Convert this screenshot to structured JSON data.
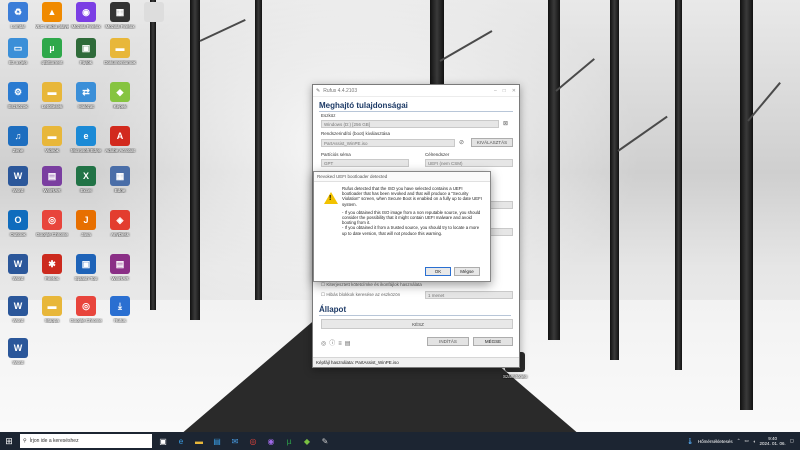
{
  "desktop": {
    "icons": [
      {
        "label": "Lomtár",
        "icon": "recycle-bin-icon",
        "color": "#3b7dd8",
        "glyph": "♻"
      },
      {
        "label": "VLC media player",
        "icon": "vlc-icon",
        "color": "#f08a00",
        "glyph": "▲"
      },
      {
        "label": "Mozilla Firefox",
        "icon": "firefox-icon",
        "color": "#7b3fe4",
        "glyph": "◉"
      },
      {
        "label": "Mozilla Firefox",
        "icon": "unknown-app-icon",
        "color": "#333333",
        "glyph": "▦"
      },
      {
        "label": "",
        "icon": "shortcut-icon",
        "color": "#dddddd",
        "glyph": ""
      },
      {
        "label": "Ez a gép",
        "icon": "this-pc-icon",
        "color": "#3b8fd8",
        "glyph": "▭"
      },
      {
        "label": "qBittorrent",
        "icon": "utorrent-icon",
        "color": "#2ea84a",
        "glyph": "µ"
      },
      {
        "label": "Fájlok",
        "icon": "app-icon",
        "color": "#2f6b3a",
        "glyph": "▣"
      },
      {
        "label": "Dokumentumok",
        "icon": "folder-icon",
        "color": "#e8b73a",
        "glyph": "▬"
      },
      {
        "label": "Eszközök",
        "icon": "tool-icon",
        "color": "#2a7bd1",
        "glyph": "⚙"
      },
      {
        "label": "Letöltések",
        "icon": "folder-icon",
        "color": "#e8b73a",
        "glyph": "▬"
      },
      {
        "label": "Hálózat",
        "icon": "network-icon",
        "color": "#3b8fd8",
        "glyph": "⇄"
      },
      {
        "label": "Képek",
        "icon": "pictures-icon",
        "color": "#86c440",
        "glyph": "◆"
      },
      {
        "label": "Zene",
        "icon": "media-icon",
        "color": "#1e6ebf",
        "glyph": "♫"
      },
      {
        "label": "Videók",
        "icon": "folder-icon",
        "color": "#e8b73a",
        "glyph": "▬"
      },
      {
        "label": "Microsoft Edge",
        "icon": "edge-icon",
        "color": "#1b8ad6",
        "glyph": "e"
      },
      {
        "label": "Adobe Acrobat",
        "icon": "acrobat-icon",
        "color": "#d22a1e",
        "glyph": "A"
      },
      {
        "label": "Word",
        "icon": "word-icon",
        "color": "#2b579a",
        "glyph": "W"
      },
      {
        "label": "WinRAR",
        "icon": "winrar-icon",
        "color": "#7a3ea0",
        "glyph": "▤"
      },
      {
        "label": "Excel",
        "icon": "excel-icon",
        "color": "#217346",
        "glyph": "X"
      },
      {
        "label": "Edge",
        "icon": "app-icon",
        "color": "#4a6ea8",
        "glyph": "▦"
      },
      {
        "label": "Outlook",
        "icon": "app-icon",
        "color": "#0f6cbd",
        "glyph": "O"
      },
      {
        "label": "Google Chrome",
        "icon": "chrome-icon",
        "color": "#e8453c",
        "glyph": "◎"
      },
      {
        "label": "Java",
        "icon": "java-icon",
        "color": "#e76f00",
        "glyph": "J"
      },
      {
        "label": "AnyDesk",
        "icon": "anydesk-icon",
        "color": "#e33d2f",
        "glyph": "◈"
      },
      {
        "label": "Word",
        "icon": "word-icon",
        "color": "#2b579a",
        "glyph": "W"
      },
      {
        "label": "Firefox",
        "icon": "app-icon",
        "color": "#cc2a1e",
        "glyph": "✱"
      },
      {
        "label": "Splash Top",
        "icon": "app-icon",
        "color": "#1e63b8",
        "glyph": "▣"
      },
      {
        "label": "WinRAR",
        "icon": "winrar-icon",
        "color": "#8a2f86",
        "glyph": "▤"
      },
      {
        "label": "Word",
        "icon": "word-icon",
        "color": "#2b579a",
        "glyph": "W"
      },
      {
        "label": "Mappa",
        "icon": "folder-icon",
        "color": "#e8b73a",
        "glyph": "▬"
      },
      {
        "label": "Google Chrome",
        "icon": "chrome-icon",
        "color": "#e8453c",
        "glyph": "◎"
      },
      {
        "label": "Rufus",
        "icon": "rufus-icon",
        "color": "#2a6fd1",
        "glyph": "⤓"
      },
      {
        "label": "Word",
        "icon": "word-icon",
        "color": "#2b579a",
        "glyph": "W"
      }
    ]
  },
  "rufus": {
    "title": "Rufus 4.4.2103",
    "section_drive": "Meghajtó tulajdonságai",
    "device_label": "Eszköz",
    "device_value": "Windows (D:) [256 GB]",
    "boot_label": "Rendszerindító (boot) kiválasztása",
    "boot_value": "PartAssist_WinPE.iso",
    "select_button": "KIVÁLASZTÁS",
    "partition_label": "Partíciós séma",
    "partition_value": "GPT",
    "target_label": "Célrendszer",
    "target_value": "UEFI (nem CSM)",
    "ext_label_option": "Kiterjesztett kötetcímke és ikonfájlok használata",
    "badblocks_option": "Hibás blokkok keresése az eszközön",
    "badblocks_value": "1 menet",
    "section_status": "Állapot",
    "status_value": "KÉSZ",
    "start_button": "INDÍTÁS",
    "cancel_button": "MÉGSE",
    "footer": "Képfájl használata: PartAssist_WinPE.iso"
  },
  "dialog": {
    "title": "Revoked UEFI bootloader detected",
    "para1": "Rufus detected that the ISO you have selected contains a UEFI bootloader that has been revoked and that will produce a \"Security Violation\" screen, when Secure Boot is enabled on a fully up to date UEFI system.",
    "para2": "- If you obtained this ISO image from a non reputable source, you should consider the possibility that it might contain UEFI malware and avoid booting from it.\n- If you obtained it from a trusted source, you should try to locate a more up to date version, that will not produce this warning.",
    "ok_button": "OK",
    "cancel_button": "Mégse"
  },
  "taskbar": {
    "search_placeholder": "Írjon ide a kereséshez",
    "weather": "Hőmérsékletesés",
    "time": "9:40",
    "date": "2024. 01. 06."
  }
}
